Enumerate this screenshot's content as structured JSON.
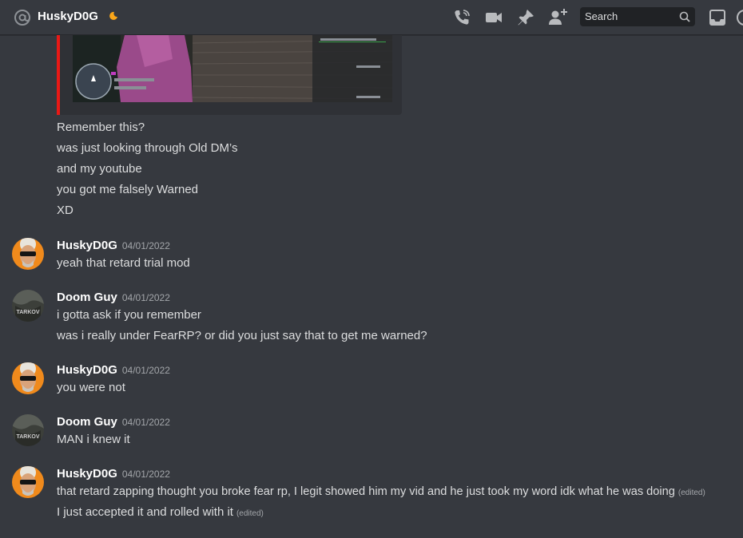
{
  "header": {
    "channel_name": "HuskyD0G",
    "search_placeholder": "Search"
  },
  "first_group": {
    "lines": [
      "Remember this?",
      "was just looking through Old DM’s",
      "and my youtube",
      "you got me falsely Warned",
      "XD"
    ]
  },
  "messages": [
    {
      "username": "HuskyD0G",
      "timestamp": "04/01/2022",
      "lines": [
        "yeah that retard trial mod"
      ]
    },
    {
      "username": "Doom Guy",
      "timestamp": "04/01/2022",
      "lines": [
        "i gotta ask if you remember",
        "was i really under FearRP? or did you just say that to get me warned?"
      ]
    },
    {
      "username": "HuskyD0G",
      "timestamp": "04/01/2022",
      "lines": [
        "you were not"
      ]
    },
    {
      "username": "Doom Guy",
      "timestamp": "04/01/2022",
      "lines": [
        "MAN i knew it"
      ]
    },
    {
      "username": "HuskyD0G",
      "timestamp": "04/01/2022",
      "lines": [
        "that retard zapping thought you broke fear rp, I legit showed him my vid and he just took my word idk what he was doing",
        "I just accepted it and rolled with it"
      ],
      "edited_label": "(edited)"
    }
  ],
  "avatar_labels": {
    "doom_guy_text": "TARKOV"
  },
  "colors": {
    "background": "#36393f",
    "embed_border": "#e91916",
    "accent_moon": "#faa61a"
  }
}
